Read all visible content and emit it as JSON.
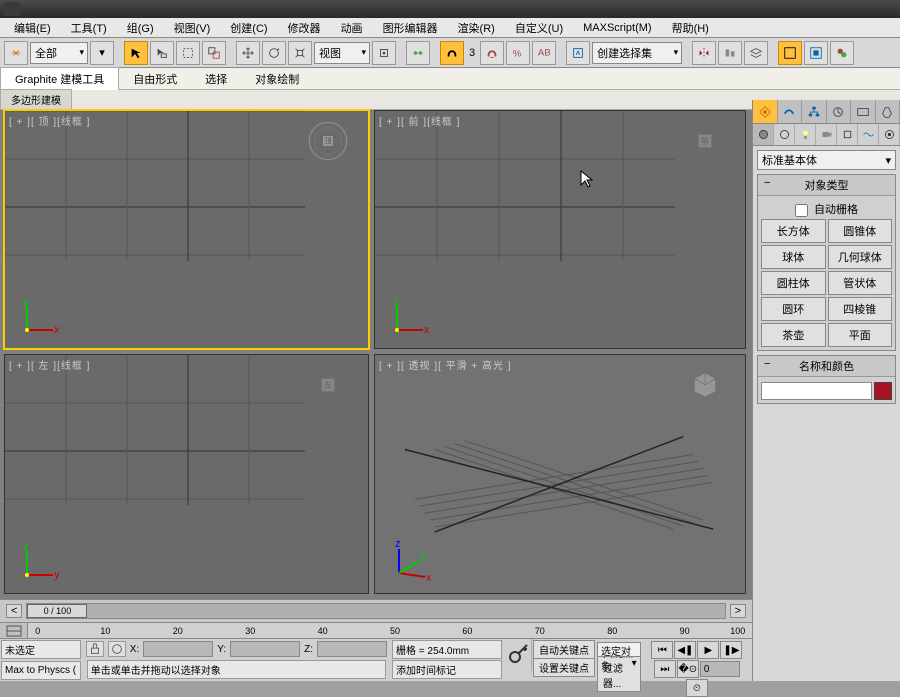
{
  "menu": {
    "items": [
      "编辑(E)",
      "工具(T)",
      "组(G)",
      "视图(V)",
      "创建(C)",
      "修改器",
      "动画",
      "图形编辑器",
      "渲染(R)",
      "自定义(U)",
      "MAXScript(M)",
      "帮助(H)"
    ]
  },
  "toolbar1": {
    "layer_sel": "全部",
    "view_sel": "视图",
    "num": "3",
    "selset": "创建选择集"
  },
  "ribbon": {
    "tabs": [
      "Graphite 建模工具",
      "自由形式",
      "选择",
      "对象绘制"
    ],
    "subtab": "多边形建模"
  },
  "viewports": {
    "top": "[ + ][ 顶 ][线框 ]",
    "front": "[ + ][ 前 ][线框 ]",
    "left": "[ + ][ 左 ][线框 ]",
    "persp": "[ + ][ 透视 ][ 平滑 + 高光 ]",
    "cube_top": "顶",
    "cube_front": "前",
    "cube_left": "左"
  },
  "cmd": {
    "dropdown": "标准基本体",
    "rollout1_title": "对象类型",
    "autogrid": "自动栅格",
    "buttons": [
      "长方体",
      "圆锥体",
      "球体",
      "几何球体",
      "圆柱体",
      "管状体",
      "圆环",
      "四棱锥",
      "茶壶",
      "平面"
    ],
    "rollout2_title": "名称和颜色"
  },
  "timeline": {
    "frame": "0 / 100",
    "ticks": [
      "0",
      "10",
      "20",
      "30",
      "40",
      "50",
      "60",
      "70",
      "80",
      "90",
      "100"
    ]
  },
  "status": {
    "sel": "未选定",
    "script": "Max to Physcs (",
    "x": "X:",
    "y": "Y:",
    "z": "Z:",
    "grid": "栅格 = 254.0mm",
    "hint": "单击或单击并拖动以选择对象",
    "addtag": "添加时间标记",
    "autokey": "自动关键点",
    "setkey": "设置关键点",
    "seldrop": "选定对象",
    "filter": "关键点过滤器..."
  }
}
